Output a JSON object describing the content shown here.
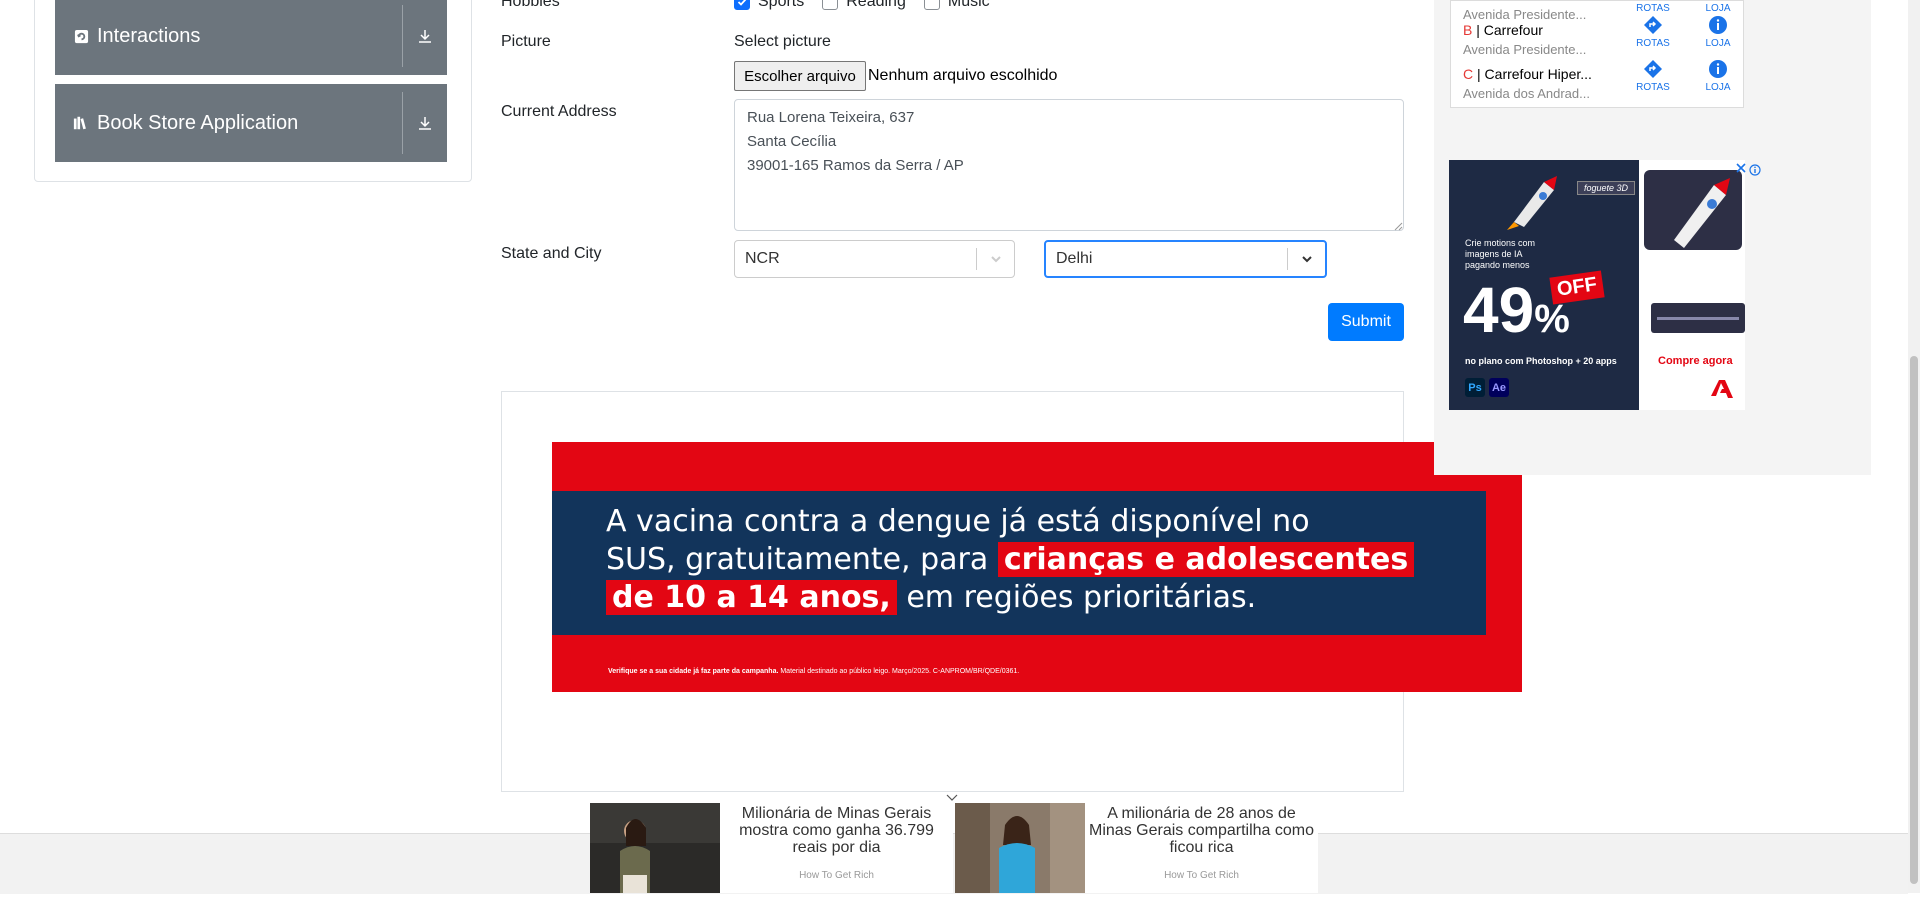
{
  "sidebar": {
    "items": [
      {
        "label": "Interactions",
        "icon": "interactions-icon"
      },
      {
        "label": "Book Store Application",
        "icon": "book-store-icon"
      }
    ]
  },
  "form": {
    "hobbies_label": "Hobbies",
    "hobbies": [
      {
        "label": "Sports",
        "checked": true
      },
      {
        "label": "Reading",
        "checked": false
      },
      {
        "label": "Music",
        "checked": false
      }
    ],
    "picture_label": "Picture",
    "picture_select_label": "Select picture",
    "file_button": "Escolher arquivo",
    "file_status": "Nenhum arquivo escolhido",
    "address_label": "Current Address",
    "address_lines": [
      "Rua Lorena Teixeira, 637",
      "Santa Cecília",
      "39001-165 Ramos da Serra / AP"
    ],
    "state_city_label": "State and City",
    "state_value": "NCR",
    "city_value": "Delhi",
    "submit_label": "Submit"
  },
  "banner": {
    "line1": "A vacina contra a dengue já está disponível no",
    "line2_plain": "SUS, gratuitamente, para ",
    "line2_highlight": "crianças e adolescentes",
    "line3_highlight": "de 10 a 14 anos,",
    "line3_plain": " em regiões prioritárias.",
    "footer_bold": "Verifique se a sua cidade já faz parte da campanha.",
    "footer_rest": " Material destinado ao público leigo. Março/2025. C-ANPROM/BR/QDE/0361."
  },
  "store_ad": {
    "stores": [
      {
        "letter": "",
        "name": "",
        "address": "Avenida Presidente..."
      },
      {
        "letter": "B",
        "name": "Carrefour",
        "address": "Avenida Presidente..."
      },
      {
        "letter": "C",
        "name": "Carrefour Hiper...",
        "address": "Avenida dos Andrad..."
      }
    ],
    "rotas_label": "ROTAS",
    "loja_label": "LOJA"
  },
  "adobe_ad": {
    "tag": "foguete 3D",
    "headline": "Crie motions com imagens de IA pagando menos",
    "percent": "49",
    "percent_sign": "%",
    "off_label": "OFF",
    "plan_text": "no plano com Photoshop + 20 apps",
    "cta": "Compre agora",
    "app1": "Ps",
    "app2": "Ae"
  },
  "news": [
    {
      "title": "Milionária de Minas Gerais mostra como ganha 36.799 reais por dia",
      "source": "How To Get Rich"
    },
    {
      "title": "A milionária de 28 anos de Minas Gerais compartilha como ficou rica",
      "source": "How To Get Rich"
    }
  ],
  "colors": {
    "sidebar_bg": "#6c757d",
    "primary": "#007bff",
    "banner_red": "#e30613",
    "banner_navy": "#12345b"
  }
}
